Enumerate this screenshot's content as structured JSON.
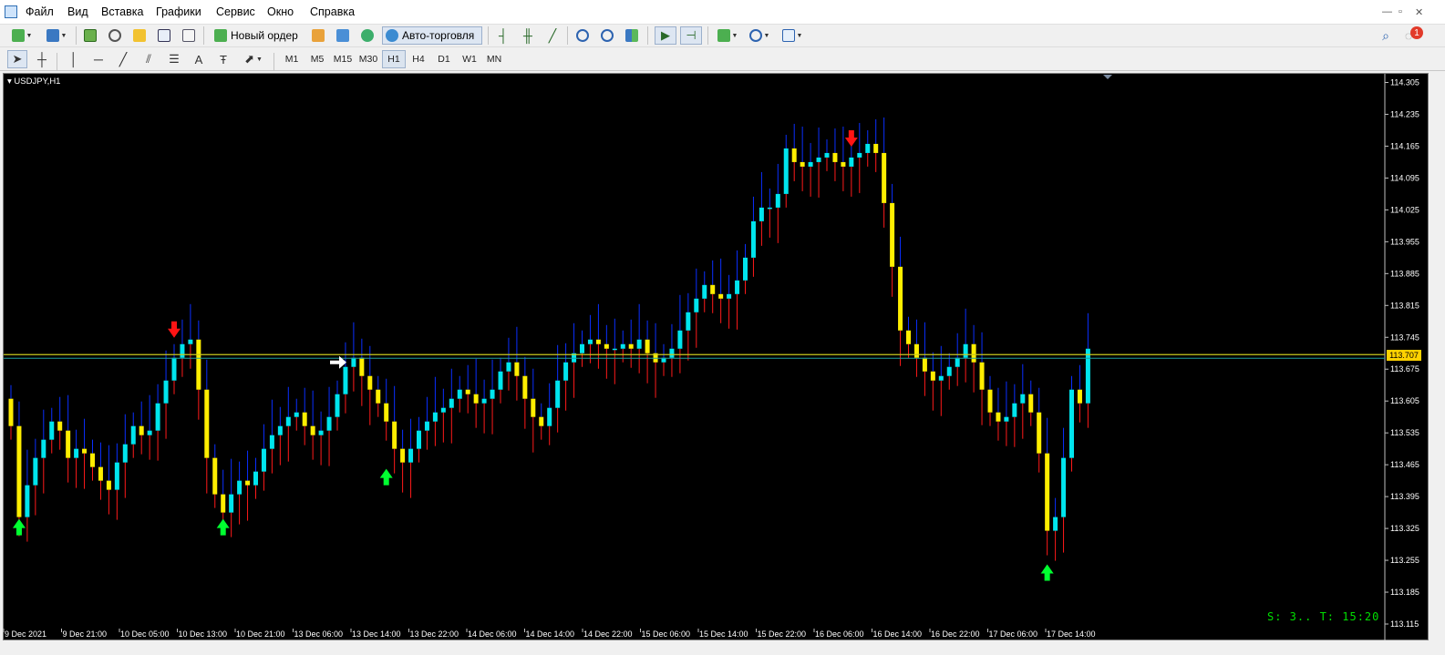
{
  "menu": [
    "Файл",
    "Вид",
    "Вставка",
    "Графики",
    "Сервис",
    "Окно",
    "Справка"
  ],
  "window_controls": [
    "—",
    "▫",
    "✕"
  ],
  "toolbar": {
    "new_order": "Новый ордер",
    "autotrade": "Авто-торговля",
    "timeframes": [
      "M1",
      "M5",
      "M15",
      "M30",
      "H1",
      "H4",
      "D1",
      "W1",
      "MN"
    ],
    "active_timeframe": "H1",
    "drawing_text_tool": "A",
    "notification_count": "1"
  },
  "chart": {
    "symbol_label": "USDJPY,H1",
    "current_price": "113.707",
    "status_text": "S: 3.. T: 15:20",
    "colors": {
      "bull": "#00e5ee",
      "bear": "#ffee00",
      "wick_up": "#0a2fff",
      "wick_down": "#ff1a1a",
      "level": "#c8c81e",
      "level_alt": "#1ea0a0",
      "arrow_up": "#00ff30",
      "arrow_down": "#ff1414",
      "arrow_neutral": "#ffffff"
    }
  },
  "chart_data": {
    "type": "candlestick",
    "y_ticks": [
      "114.305",
      "114.235",
      "114.165",
      "114.095",
      "114.025",
      "113.955",
      "113.885",
      "113.815",
      "113.745",
      "113.675",
      "113.605",
      "113.535",
      "113.465",
      "113.395",
      "113.325",
      "113.255",
      "113.185",
      "113.115"
    ],
    "x_ticks": [
      "9 Dec 2021",
      "9 Dec 21:00",
      "10 Dec 05:00",
      "10 Dec 13:00",
      "10 Dec 21:00",
      "13 Dec 06:00",
      "13 Dec 14:00",
      "13 Dec 22:00",
      "14 Dec 06:00",
      "14 Dec 14:00",
      "14 Dec 22:00",
      "15 Dec 06:00",
      "15 Dec 14:00",
      "15 Dec 22:00",
      "16 Dec 06:00",
      "16 Dec 14:00",
      "16 Dec 22:00",
      "17 Dec 06:00",
      "17 Dec 14:00"
    ],
    "ylim": [
      113.105,
      114.318
    ],
    "horizontal_levels": [
      113.707,
      113.703
    ],
    "closes": [
      113.55,
      113.35,
      113.42,
      113.48,
      113.52,
      113.56,
      113.54,
      113.48,
      113.5,
      113.49,
      113.46,
      113.43,
      113.41,
      113.47,
      113.51,
      113.55,
      113.53,
      113.54,
      113.6,
      113.65,
      113.7,
      113.73,
      113.74,
      113.63,
      113.48,
      113.4,
      113.36,
      113.4,
      113.43,
      113.42,
      113.45,
      113.5,
      113.53,
      113.55,
      113.57,
      113.58,
      113.55,
      113.53,
      113.54,
      113.57,
      113.62,
      113.68,
      113.7,
      113.66,
      113.63,
      113.6,
      113.56,
      113.5,
      113.47,
      113.5,
      113.54,
      113.56,
      113.58,
      113.59,
      113.61,
      113.63,
      113.62,
      113.6,
      113.61,
      113.63,
      113.67,
      113.69,
      113.66,
      113.61,
      113.57,
      113.55,
      113.59,
      113.65,
      113.69,
      113.71,
      113.73,
      113.74,
      113.73,
      113.72,
      113.72,
      113.73,
      113.72,
      113.74,
      113.71,
      113.69,
      113.7,
      113.72,
      113.76,
      113.8,
      113.83,
      113.86,
      113.84,
      113.83,
      113.84,
      113.87,
      113.92,
      114.0,
      114.03,
      114.03,
      114.06,
      114.16,
      114.13,
      114.12,
      114.13,
      114.14,
      114.15,
      114.13,
      114.12,
      114.14,
      114.15,
      114.17,
      114.15,
      114.04,
      113.9,
      113.76,
      113.73,
      113.7,
      113.67,
      113.65,
      113.66,
      113.68,
      113.7,
      113.73,
      113.69,
      113.63,
      113.58,
      113.56,
      113.57,
      113.6,
      113.62,
      113.58,
      113.49,
      113.32,
      113.35,
      113.48,
      113.63,
      113.6,
      113.72
    ]
  }
}
